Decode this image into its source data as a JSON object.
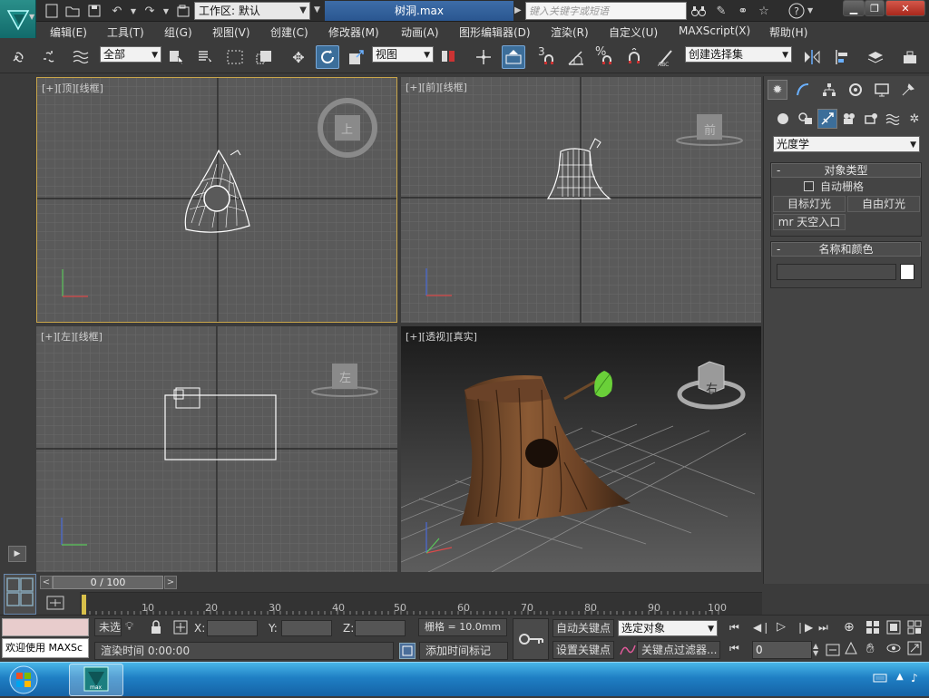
{
  "title_bar": {
    "workspace_label": "工作区: 默认",
    "file_title": "树洞.max",
    "search_placeholder": "键入关键字或短语"
  },
  "menu": [
    "编辑(E)",
    "工具(T)",
    "组(G)",
    "视图(V)",
    "创建(C)",
    "修改器(M)",
    "动画(A)",
    "图形编辑器(D)",
    "渲染(R)",
    "自定义(U)",
    "MAXScript(X)",
    "帮助(H)"
  ],
  "toolbar": {
    "selection_filter": "全部",
    "ref_coord": "视图",
    "named_selection": "创建选择集",
    "snap_3": "3",
    "percent": "%"
  },
  "viewports": {
    "top": "[+][顶][线框]",
    "front": "[+][前][线框]",
    "left": "[+][左][线框]",
    "persp": "[+][透视][真实]",
    "cube_top": "上",
    "cube_front": "前",
    "cube_left": "左",
    "cube_persp": "右"
  },
  "command_panel": {
    "dropdown": "光度学",
    "object_type_title": "对象类型",
    "auto_grid": "自动栅格",
    "btn_target_light": "目标灯光",
    "btn_free_light": "自由灯光",
    "btn_mr_sky": "mr 天空入口",
    "name_color_title": "名称和颜色",
    "minus": "-"
  },
  "timeline": {
    "frame_counter": "0 / 100",
    "ticks": [
      "10",
      "20",
      "30",
      "40",
      "50",
      "60",
      "70",
      "80",
      "90",
      "100"
    ]
  },
  "status": {
    "maxscript_prompt": "欢迎使用 MAXSc",
    "unselected": "未选",
    "x_label": "X:",
    "y_label": "Y:",
    "z_label": "Z:",
    "grid": "栅格 = 10.0mm",
    "auto_key": "自动关键点",
    "key_mode": "选定对象",
    "set_key": "设置关键点",
    "key_filter": "关键点过滤器...",
    "render_time": "渲染时间  0:00:00",
    "add_time_tag": "添加时间标记",
    "frame_value": "0"
  },
  "taskbar": {
    "app": "max"
  },
  "colors": {
    "title_active": "#2a5690",
    "viewport_active_border": "#c9a64a",
    "tool_active": "#3c6e9a"
  }
}
